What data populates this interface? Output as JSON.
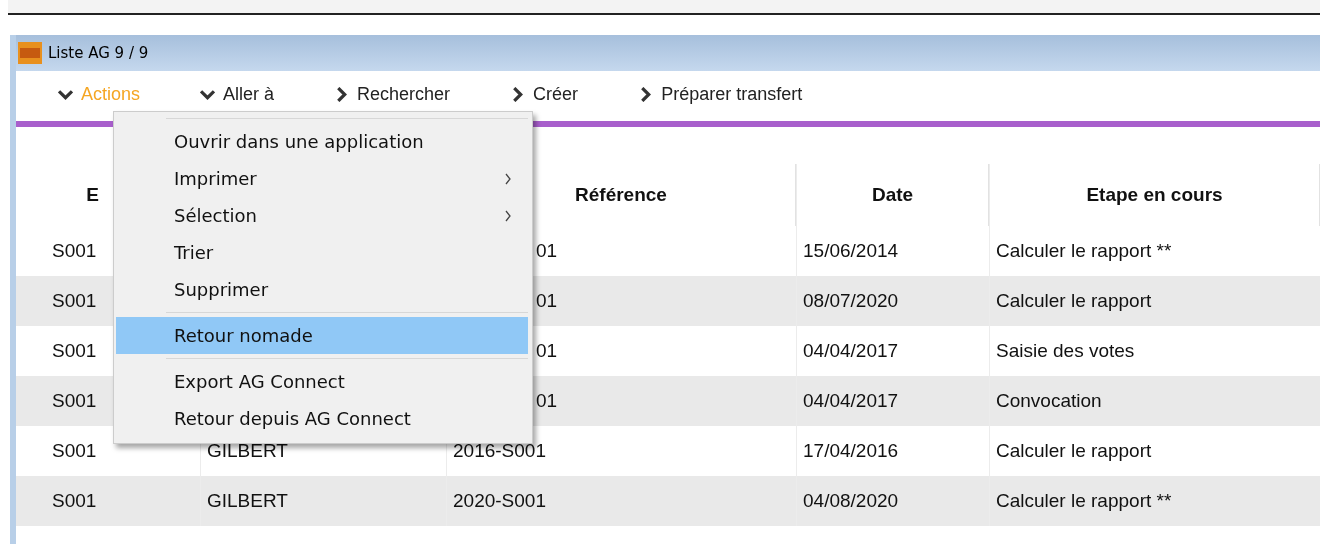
{
  "window": {
    "title": "Liste  AG 9 / 9"
  },
  "toolbar": [
    {
      "label": "Actions",
      "kind": "expanded",
      "selected": true
    },
    {
      "label": "Aller à",
      "kind": "expanded",
      "selected": false
    },
    {
      "label": "Rechercher",
      "kind": "collapsed",
      "selected": false
    },
    {
      "label": "Créer",
      "kind": "collapsed",
      "selected": false
    },
    {
      "label": "Préparer transfert",
      "kind": "collapsed",
      "selected": false
    }
  ],
  "table": {
    "columns": [
      {
        "label": "E"
      },
      {},
      {
        "label": "Référence"
      },
      {
        "label": "Date"
      },
      {
        "label": "Etape en cours"
      }
    ],
    "rows": [
      {
        "cells": [
          "S001",
          null,
          "01",
          "15/06/2014",
          "Calculer le rapport **"
        ]
      },
      {
        "cells": [
          "S001",
          null,
          "01",
          "08/07/2020",
          "Calculer le rapport"
        ]
      },
      {
        "cells": [
          "S001",
          null,
          "01",
          "04/04/2017",
          "Saisie des votes"
        ]
      },
      {
        "cells": [
          "S001",
          null,
          "01",
          "04/04/2017",
          "Convocation"
        ]
      },
      {
        "cells": [
          "S001",
          "GILBERT",
          "2016-S001",
          "17/04/2016",
          "Calculer le rapport"
        ]
      },
      {
        "cells": [
          "S001",
          "GILBERT",
          "2020-S001",
          "04/08/2020",
          "Calculer le rapport **"
        ]
      }
    ]
  },
  "context_menu": {
    "items": [
      {
        "kind": "item",
        "label": "Ouvrir dans une application",
        "submenu": false,
        "selected": false
      },
      {
        "kind": "item",
        "label": "Imprimer",
        "submenu": true,
        "selected": false
      },
      {
        "kind": "item",
        "label": "Sélection",
        "submenu": true,
        "selected": false
      },
      {
        "kind": "item",
        "label": "Trier",
        "submenu": false,
        "selected": false
      },
      {
        "kind": "item",
        "label": "Supprimer",
        "submenu": false,
        "selected": false
      },
      {
        "kind": "separator"
      },
      {
        "kind": "item",
        "label": "Retour nomade",
        "submenu": false,
        "selected": true
      },
      {
        "kind": "separator"
      },
      {
        "kind": "item",
        "label": "Export AG Connect",
        "submenu": false,
        "selected": false
      },
      {
        "kind": "item",
        "label": "Retour depuis AG Connect",
        "submenu": false,
        "selected": false
      }
    ]
  }
}
